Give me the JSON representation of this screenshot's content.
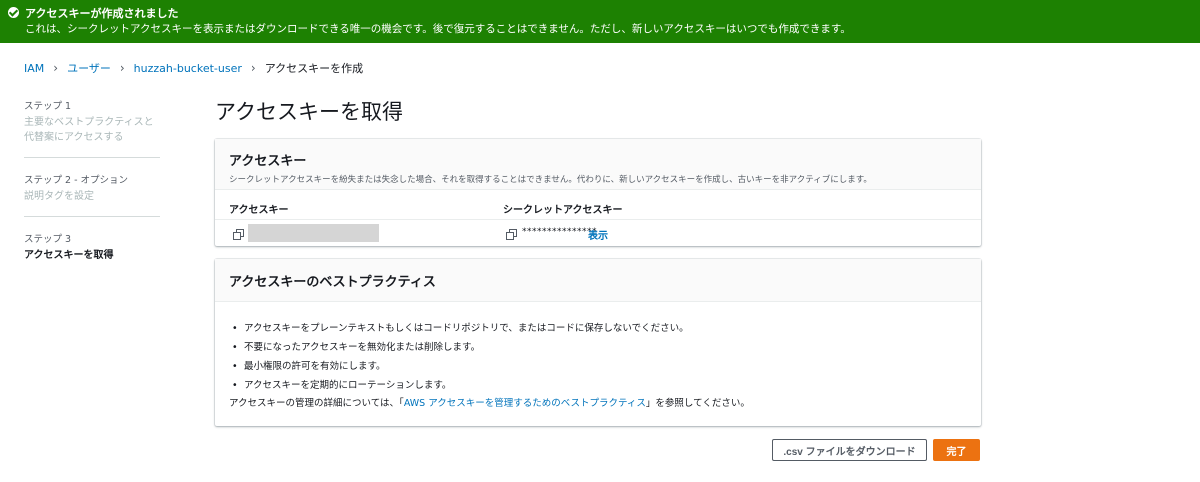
{
  "banner": {
    "title": "アクセスキーが作成されました",
    "text": "これは、シークレットアクセスキーを表示またはダウンロードできる唯一の機会です。後で復元することはできません。ただし、新しいアクセスキーはいつでも作成できます。",
    "color": "#1d8102"
  },
  "breadcrumb": {
    "items": [
      "IAM",
      "ユーザー",
      "huzzah-bucket-user"
    ],
    "current": "アクセスキーを作成"
  },
  "steps": [
    {
      "num": "ステップ 1",
      "name": "主要なベストプラクティスと代替案にアクセスする"
    },
    {
      "num": "ステップ 2 - オプション",
      "name": "説明タグを設定"
    },
    {
      "num": "ステップ 3",
      "name": "アクセスキーを取得"
    }
  ],
  "page_title": "アクセスキーを取得",
  "access_key_card": {
    "title": "アクセスキー",
    "description": "シークレットアクセスキーを紛失または失念した場合、それを取得することはできません。代わりに、新しいアクセスキーを作成し、古いキーを非アクティブにします。",
    "col_access_key": "アクセスキー",
    "col_secret_key": "シークレットアクセスキー",
    "secret_masked": "***************",
    "show_label": "表示"
  },
  "best_practices_card": {
    "title": "アクセスキーのベストプラクティス",
    "items": [
      "アクセスキーをプレーンテキストもしくはコードリポジトリで、またはコードに保存しないでください。",
      "不要になったアクセスキーを無効化または削除します。",
      "最小権限の許可を有効にします。",
      "アクセスキーを定期的にローテーションします。"
    ],
    "footer_prefix": "アクセスキーの管理の詳細については、「",
    "footer_link": "AWS アクセスキーを管理するためのベストプラクティス",
    "footer_suffix": "」を参照してください。"
  },
  "buttons": {
    "download": ".csv ファイルをダウンロード",
    "done": "完了",
    "done_color": "#ec7211"
  }
}
